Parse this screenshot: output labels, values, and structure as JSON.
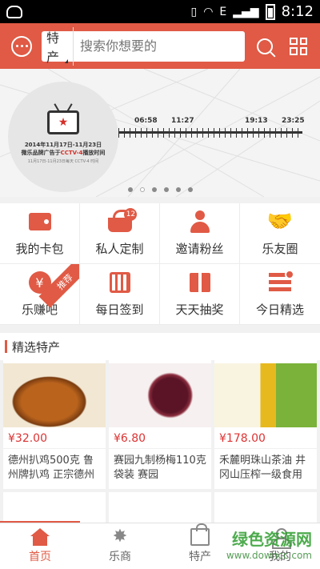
{
  "status": {
    "time": "8:12",
    "network": "E"
  },
  "header": {
    "search_category": "特产",
    "search_placeholder": "搜索你想要的"
  },
  "banner": {
    "line1": "2014年11月17日-11月23日",
    "line2_prefix": "微乐品牌广告于",
    "line2_highlight": "CCTV-4",
    "line2_suffix": "播放时间",
    "line3": "11月17日-11月23日每天  CCTV-4 时间",
    "times": [
      "06:58",
      "11:27",
      "19:13",
      "23:25"
    ],
    "slides": 6,
    "active_slide": 1
  },
  "menu": [
    {
      "label": "我的卡包",
      "icon": "wallet-icon"
    },
    {
      "label": "私人定制",
      "icon": "basket-icon",
      "badge": "12"
    },
    {
      "label": "邀请粉丝",
      "icon": "person-icon"
    },
    {
      "label": "乐友圈",
      "icon": "handshake-icon"
    },
    {
      "label": "乐赚吧",
      "icon": "yen-coin-icon",
      "ribbon": "推荐"
    },
    {
      "label": "每日签到",
      "icon": "calendar-icon"
    },
    {
      "label": "天天抽奖",
      "icon": "gift-icon"
    },
    {
      "label": "今日精选",
      "icon": "list-icon"
    }
  ],
  "section": {
    "title": "精选特产"
  },
  "products": [
    {
      "price": "¥32.00",
      "name": "德州扒鸡500克 鲁州牌扒鸡 正宗德州"
    },
    {
      "price": "¥6.80",
      "name": "赛园九制杨梅110克袋装 赛园"
    },
    {
      "price": "¥178.00",
      "name": "禾麓明珠山茶油 井冈山压榨一级食用"
    }
  ],
  "tabs": [
    {
      "label": "首页",
      "icon": "home-icon",
      "active": true
    },
    {
      "label": "乐商",
      "icon": "star-icon",
      "active": false
    },
    {
      "label": "特产",
      "icon": "bag-icon",
      "active": false
    },
    {
      "label": "我的",
      "icon": "user-icon",
      "active": false
    }
  ],
  "watermark": {
    "line1": "绿色资源网",
    "line2": "www.downcc.com"
  },
  "colors": {
    "brand": "#e05a45",
    "price": "#dd3333"
  }
}
